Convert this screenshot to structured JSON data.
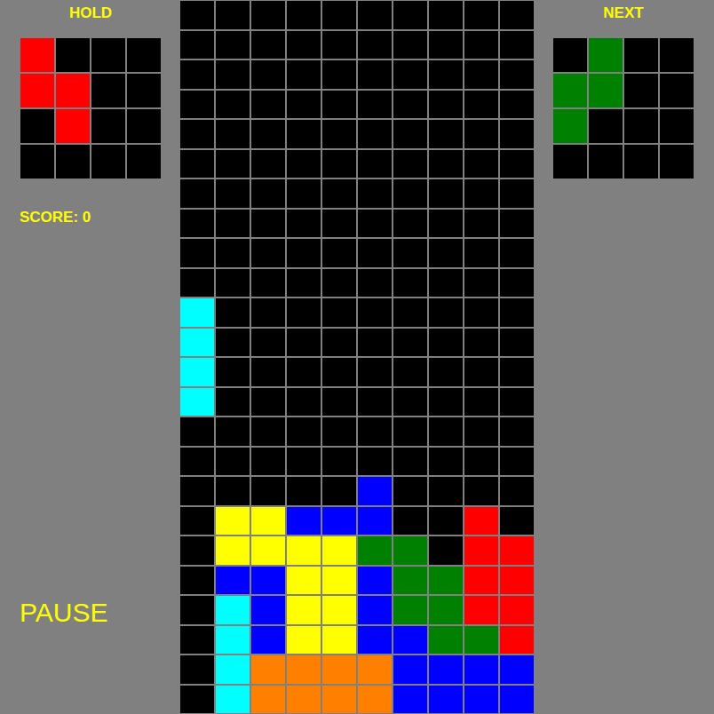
{
  "hold": {
    "label": "HOLD",
    "cells": [
      [
        "#ff0000",
        "",
        "",
        ""
      ],
      [
        "#ff0000",
        "#ff0000",
        "",
        ""
      ],
      [
        "",
        "#ff0000",
        "",
        ""
      ],
      [
        "",
        "",
        "",
        ""
      ]
    ]
  },
  "next": {
    "label": "NEXT",
    "cells": [
      [
        "",
        "#008000",
        "",
        ""
      ],
      [
        "#008000",
        "#008000",
        "",
        ""
      ],
      [
        "#008000",
        "",
        "",
        ""
      ],
      [
        "",
        "",
        "",
        ""
      ]
    ]
  },
  "score": "SCORE: 0",
  "status": "PAUSE",
  "board": {
    "rows": [
      [
        "",
        "",
        "",
        "",
        "",
        "",
        "",
        "",
        "",
        ""
      ],
      [
        "",
        "",
        "",
        "",
        "",
        "",
        "",
        "",
        "",
        ""
      ],
      [
        "",
        "",
        "",
        "",
        "",
        "",
        "",
        "",
        "",
        ""
      ],
      [
        "",
        "",
        "",
        "",
        "",
        "",
        "",
        "",
        "",
        ""
      ],
      [
        "",
        "",
        "",
        "",
        "",
        "",
        "",
        "",
        "",
        ""
      ],
      [
        "",
        "",
        "",
        "",
        "",
        "",
        "",
        "",
        "",
        ""
      ],
      [
        "",
        "",
        "",
        "",
        "",
        "",
        "",
        "",
        "",
        ""
      ],
      [
        "",
        "",
        "",
        "",
        "",
        "",
        "",
        "",
        "",
        ""
      ],
      [
        "",
        "",
        "",
        "",
        "",
        "",
        "",
        "",
        "",
        ""
      ],
      [
        "",
        "",
        "",
        "",
        "",
        "",
        "",
        "",
        "",
        ""
      ],
      [
        "#00ffff",
        "",
        "",
        "",
        "",
        "",
        "",
        "",
        "",
        ""
      ],
      [
        "#00ffff",
        "",
        "",
        "",
        "",
        "",
        "",
        "",
        "",
        ""
      ],
      [
        "#00ffff",
        "",
        "",
        "",
        "",
        "",
        "",
        "",
        "",
        ""
      ],
      [
        "#00ffff",
        "",
        "",
        "",
        "",
        "",
        "",
        "",
        "",
        ""
      ],
      [
        "",
        "",
        "",
        "",
        "",
        "",
        "",
        "",
        "",
        ""
      ],
      [
        "",
        "",
        "",
        "",
        "",
        "",
        "",
        "",
        "",
        ""
      ],
      [
        "",
        "",
        "",
        "",
        "",
        "#0000ff",
        "",
        "",
        "",
        ""
      ],
      [
        "",
        "#ffff00",
        "#ffff00",
        "#0000ff",
        "#0000ff",
        "#0000ff",
        "",
        "",
        "#ff0000",
        ""
      ],
      [
        "",
        "#ffff00",
        "#ffff00",
        "#ffff00",
        "#ffff00",
        "#008000",
        "#008000",
        "",
        "#ff0000",
        "#ff0000"
      ],
      [
        "",
        "#0000ff",
        "#0000ff",
        "#ffff00",
        "#ffff00",
        "#0000ff",
        "#008000",
        "#008000",
        "#ff0000",
        "#ff0000"
      ],
      [
        "",
        "#00ffff",
        "#0000ff",
        "#ffff00",
        "#ffff00",
        "#0000ff",
        "#008000",
        "#008000",
        "#ff0000",
        "#ff0000"
      ],
      [
        "",
        "#00ffff",
        "#0000ff",
        "#ffff00",
        "#ffff00",
        "#0000ff",
        "#0000ff",
        "#008000",
        "#008000",
        "#ff0000"
      ],
      [
        "",
        "#00ffff",
        "#ff8000",
        "#ff8000",
        "#ff8000",
        "#ff8000",
        "#0000ff",
        "#0000ff",
        "#0000ff",
        "#0000ff"
      ],
      [
        "",
        "#00ffff",
        "#ff8000",
        "#ff8000",
        "#ff8000",
        "#ff8000",
        "#0000ff",
        "#0000ff",
        "#0000ff",
        "#0000ff"
      ]
    ]
  }
}
